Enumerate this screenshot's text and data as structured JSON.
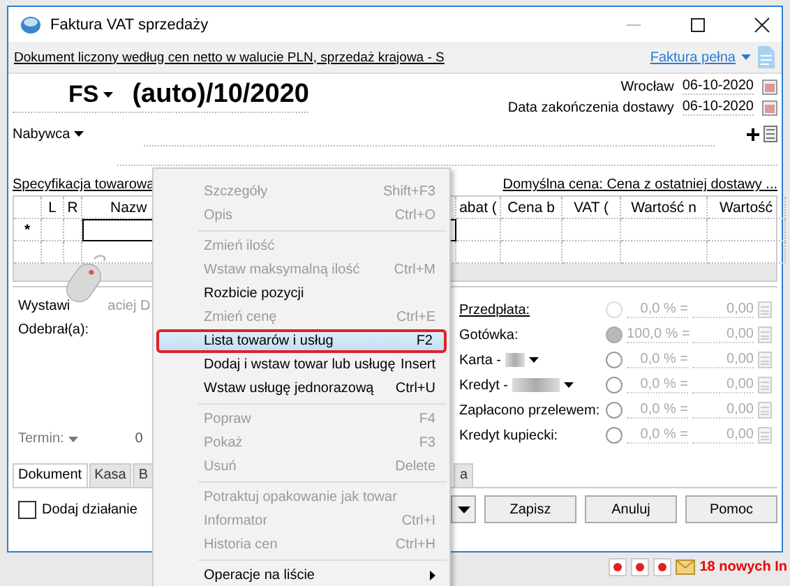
{
  "window": {
    "title": "Faktura VAT sprzedaży"
  },
  "info_bar": {
    "text": "Dokument liczony według cen netto w walucie PLN, sprzedaż krajowa - S",
    "invoice_type": "Faktura pełna"
  },
  "header": {
    "series": "FS",
    "number": "(auto)/10/2020",
    "place": "Wrocław",
    "issue_date": "06-10-2020",
    "delivery_label": "Data zakończenia dostawy",
    "delivery_date": "06-10-2020"
  },
  "buyer": {
    "label": "Nabywca"
  },
  "spec": {
    "title": "Specyfikacja towarowa",
    "default_price": "Domyślna cena: Cena z ostatniej dostawy ..."
  },
  "table": {
    "new_row_marker": "*",
    "columns": [
      "L",
      "R",
      "Nazw",
      "abat (",
      "Cena b",
      "VAT (",
      "Wartość n",
      "Wartość"
    ]
  },
  "issued_by": {
    "label": "Wystawi",
    "placeholder": "aciej D"
  },
  "received_by": {
    "label": "Odebrał(a):"
  },
  "term": {
    "label": "Termin:",
    "value": "0"
  },
  "payments": [
    {
      "label": "Przedpłata:",
      "kind": "link",
      "selected": false,
      "disabled": true,
      "percent": "0,0 % =",
      "amount": "0,00"
    },
    {
      "label": "Gotówka:",
      "kind": "plain",
      "selected": true,
      "disabled": false,
      "percent": "100,0 % =",
      "amount": "0,00"
    },
    {
      "label": "Karta -",
      "kind": "dropdown",
      "selected": false,
      "disabled": false,
      "percent": "0,0 % =",
      "amount": "0,00"
    },
    {
      "label": "Kredyt -",
      "kind": "dropdown",
      "selected": false,
      "disabled": false,
      "percent": "0,0 % =",
      "amount": "0,00"
    },
    {
      "label": "Zapłacono przelewem:",
      "kind": "plain",
      "selected": false,
      "disabled": false,
      "percent": "0,0 % =",
      "amount": "0,00"
    },
    {
      "label": "Kredyt kupiecki:",
      "kind": "plain",
      "selected": false,
      "disabled": false,
      "percent": "0,0 % =",
      "amount": "0,00"
    }
  ],
  "tabs": [
    {
      "label": "Dokument",
      "selected": true
    },
    {
      "label": "Kasa",
      "selected": false
    },
    {
      "label": "B",
      "selected": false
    },
    {
      "label": "a",
      "selected": false
    }
  ],
  "add_action": {
    "label": "Dodaj działanie",
    "checked": false
  },
  "buttons": [
    "Zapisz",
    "Anuluj",
    "Pomoc"
  ],
  "status": {
    "notice": "18 nowych In"
  },
  "context_menu": {
    "groups": [
      [
        {
          "label": "Szczegóły",
          "shortcut": "Shift+F3",
          "disabled": true,
          "selected": false
        },
        {
          "label": "Opis",
          "shortcut": "Ctrl+O",
          "disabled": true,
          "selected": false
        }
      ],
      [
        {
          "label": "Zmień ilość",
          "disabled": true,
          "selected": false
        },
        {
          "label": "Wstaw maksymalną ilość",
          "shortcut": "Ctrl+M",
          "disabled": true,
          "selected": false
        },
        {
          "label": "Rozbicie pozycji",
          "disabled": false,
          "selected": false
        },
        {
          "label": "Zmień cenę",
          "shortcut": "Ctrl+E",
          "disabled": true,
          "selected": false
        },
        {
          "label": "Lista towarów i usług",
          "shortcut": "F2",
          "disabled": false,
          "selected": true
        },
        {
          "label": "Dodaj i wstaw towar lub usługę",
          "shortcut": "Insert",
          "disabled": false,
          "selected": false
        },
        {
          "label": "Wstaw usługę jednorazową",
          "shortcut": "Ctrl+U",
          "disabled": false,
          "selected": false
        }
      ],
      [
        {
          "label": "Popraw",
          "shortcut": "F4",
          "disabled": true,
          "selected": false
        },
        {
          "label": "Pokaż",
          "shortcut": "F3",
          "disabled": true,
          "selected": false
        },
        {
          "label": "Usuń",
          "shortcut": "Delete",
          "disabled": true,
          "selected": false
        }
      ],
      [
        {
          "label": "Potraktuj opakowanie jak towar",
          "disabled": true,
          "selected": false
        },
        {
          "label": "Informator",
          "shortcut": "Ctrl+I",
          "disabled": true,
          "selected": false
        },
        {
          "label": "Historia cen",
          "shortcut": "Ctrl+H",
          "disabled": true,
          "selected": false
        }
      ],
      [
        {
          "label": "Operacje na liście",
          "disabled": false,
          "selected": false,
          "submenu": true
        }
      ]
    ]
  }
}
